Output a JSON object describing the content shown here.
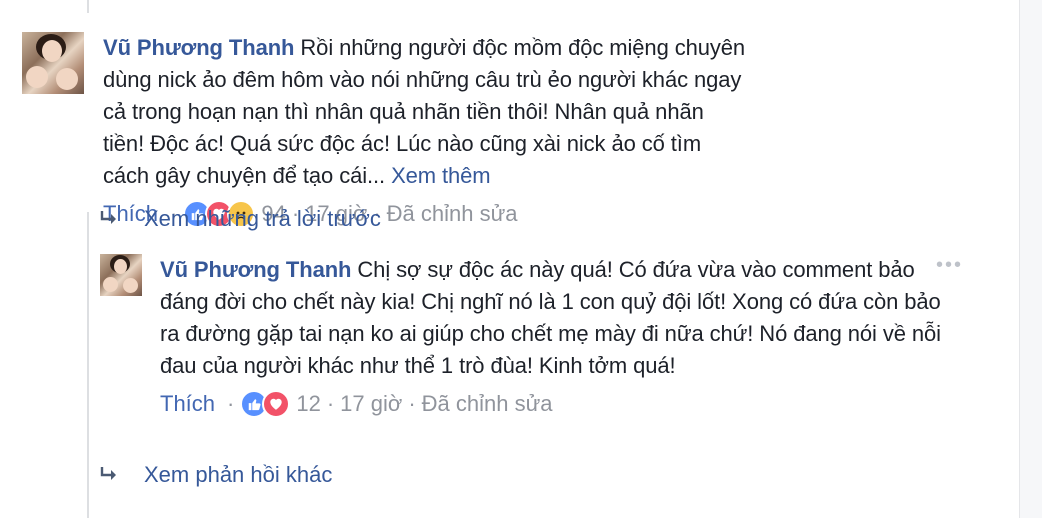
{
  "comments": [
    {
      "author": "Vũ Phương Thanh",
      "text": "Rồi những người độc mồm độc miệng chuyên dùng nick ảo đêm hôm vào nói những câu trù ẻo người khác ngay cả trong hoạn nạn thì nhân quả nhãn tiền thôi! Nhân quả nhãn tiền! Độc ác! Quá sức độc ác! Lúc nào cũng xài nick ảo cố tìm cách gây chuyện để tạo cái...",
      "see_more": "Xem thêm",
      "like_label": "Thích",
      "separator": "·",
      "reaction_count": "94",
      "time": "17 giờ",
      "edited": "Đã chỉnh sửa",
      "reactions": [
        "like",
        "love",
        "sad"
      ]
    },
    {
      "author": "Vũ Phương Thanh",
      "text": "Chị sợ sự độc ác này quá! Có đứa vừa vào comment bảo đáng đời cho chết này kia! Chị nghĩ nó là 1 con quỷ đội lốt! Xong có đứa còn bảo ra đường gặp tai nạn ko ai giúp cho chết mẹ mày đi nữa chứ! Nó đang nói về nỗi đau của người khác như thể 1 trò đùa! Kinh tởm quá!",
      "like_label": "Thích",
      "separator": "·",
      "reaction_count": "12",
      "time": "17 giờ",
      "edited": "Đã chỉnh sửa",
      "reactions": [
        "like",
        "love"
      ],
      "more_options": "•••"
    }
  ],
  "reply_links": {
    "previous_replies": "Xem những trả lời trước",
    "more_replies": "Xem phản hồi khác"
  },
  "colors": {
    "link": "#365899",
    "like_link": "#4267b2",
    "meta": "#90949c",
    "text": "#1d2129"
  },
  "icons": {
    "reply_arrow": "reply-arrow-icon",
    "like": "like-reaction-icon",
    "love": "love-reaction-icon",
    "sad": "sad-reaction-icon"
  }
}
